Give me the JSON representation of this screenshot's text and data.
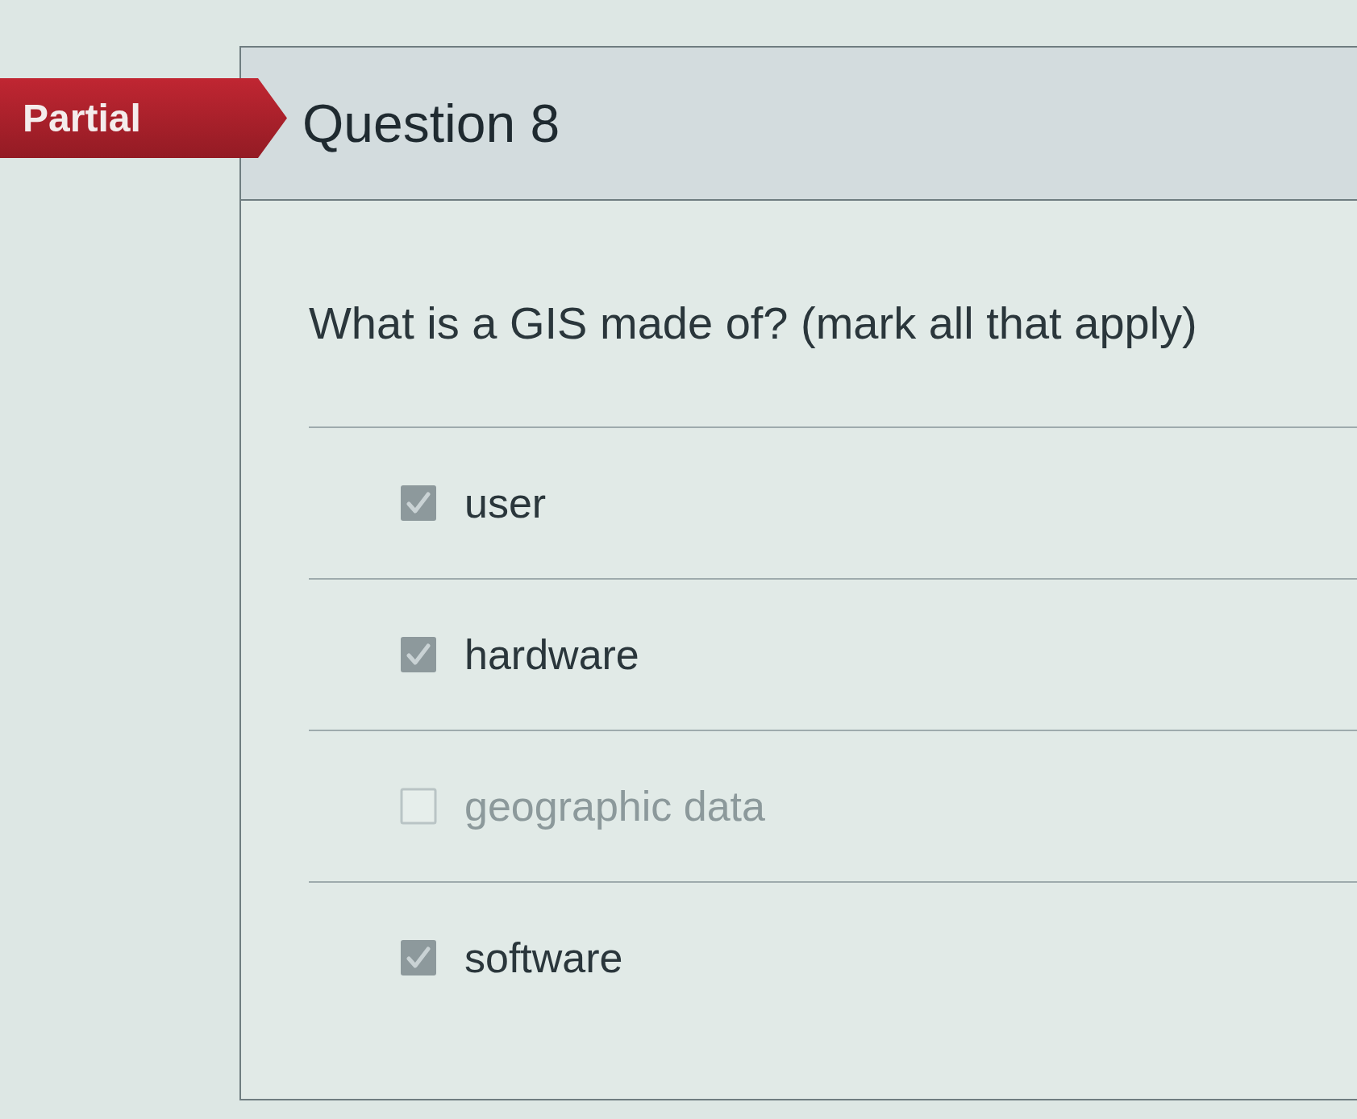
{
  "grade_banner": {
    "label": "Partial"
  },
  "question": {
    "title": "Question 8",
    "text": "What is a GIS made of? (mark all that apply)",
    "answers": [
      {
        "label": "user",
        "checked": true
      },
      {
        "label": "hardware",
        "checked": true
      },
      {
        "label": "geographic data",
        "checked": false
      },
      {
        "label": "software",
        "checked": true
      }
    ]
  }
}
